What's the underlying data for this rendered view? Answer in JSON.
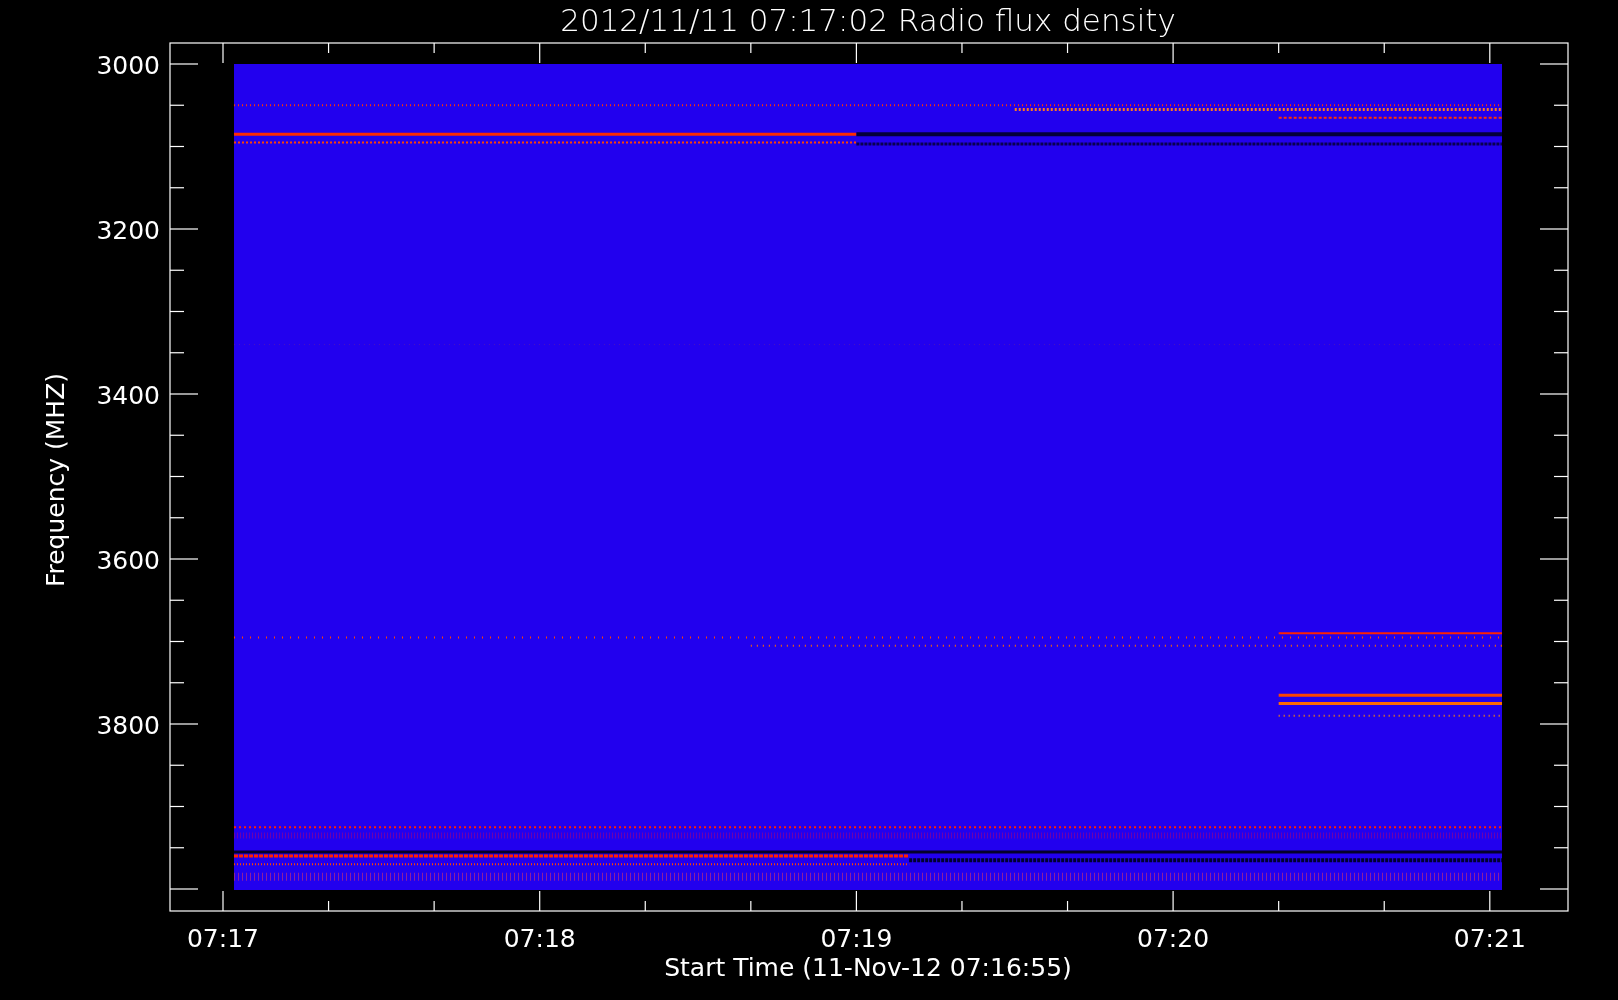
{
  "title": "2012/11/11 07:17:02 Radio flux density",
  "y_axis": {
    "label": "Frequency (MHZ)",
    "ticks": [
      "3000",
      "3200",
      "3400",
      "3600",
      "3800"
    ]
  },
  "x_axis": {
    "label": "Start Time (11-Nov-12 07:16:55)",
    "ticks": [
      "07:17",
      "07:18",
      "07:19",
      "07:20",
      "07:21"
    ]
  }
}
